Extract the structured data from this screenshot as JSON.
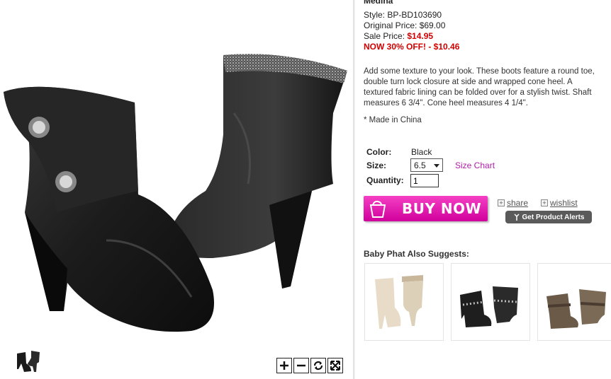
{
  "product": {
    "name": "Medina",
    "style_label": "Style:",
    "style_value": "BP-BD103690",
    "original_price_label": "Original Price:",
    "original_price_value": "$69.00",
    "sale_price_label": "Sale Price:",
    "sale_price_value": "$14.95",
    "promo": "NOW 30% OFF! - $10.46",
    "description": "Add some texture to your look. These boots feature a round toe, double turn lock closure at side and wrapped cone heel. A textured fabric lining can be folded over for a stylish twist. Shaft measures 6 3/4\". Cone heel measures 4 1/4\".",
    "made_in": "* Made in China"
  },
  "options": {
    "color_label": "Color:",
    "color_value": "Black",
    "size_label": "Size:",
    "size_value": "6.5",
    "size_chart_label": "Size Chart",
    "quantity_label": "Quantity:",
    "quantity_value": "1"
  },
  "actions": {
    "buy_now_label": "BUY NOW",
    "share_label": "share",
    "wishlist_label": "wishlist",
    "product_alerts_label": "Get Product Alerts"
  },
  "suggestions": {
    "title": "Baby Phat Also Suggests:",
    "items": [
      {
        "icon": "cream-boots-thumbnail"
      },
      {
        "icon": "black-studded-boots-thumbnail"
      },
      {
        "icon": "brown-slouch-boots-thumbnail"
      }
    ]
  },
  "image_viewer": {
    "zoom_in_icon": "plus-icon",
    "zoom_out_icon": "minus-icon",
    "rotate_icon": "refresh-icon",
    "fullscreen_icon": "expand-icon"
  },
  "colors": {
    "sale_red": "#d10000",
    "buy_now_pink": "#e51fb4",
    "link_purple": "#b01ca8"
  }
}
